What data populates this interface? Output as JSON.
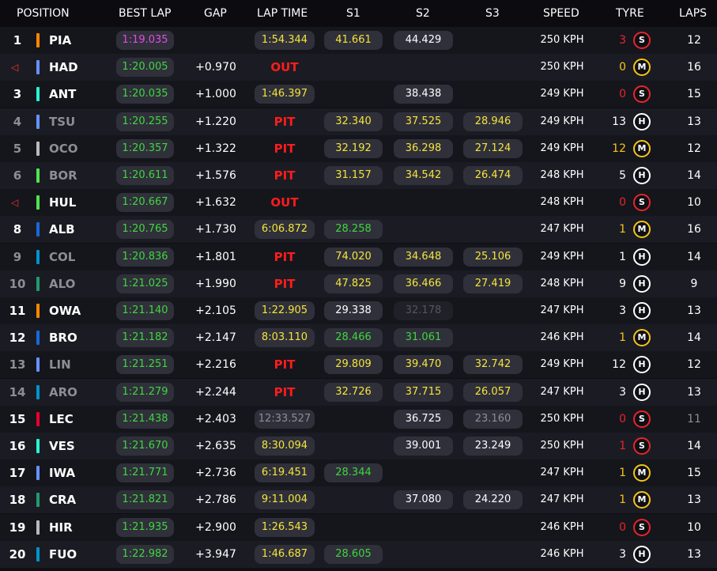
{
  "header": {
    "position": "POSITION",
    "best_lap": "BEST LAP",
    "gap": "GAP",
    "lap_time": "LAP TIME",
    "s1": "S1",
    "s2": "S2",
    "s3": "S3",
    "speed": "SPEED",
    "tyre": "TYRE",
    "laps": "LAPS"
  },
  "tyre_colors": {
    "S": "#e8242c",
    "M": "#f5c518",
    "H": "#ffffff"
  },
  "rows": [
    {
      "pos": "1",
      "flag": false,
      "team": "#ff8700",
      "driver": "PIA",
      "dim": false,
      "best": "1:19.035",
      "best_c": "purple",
      "gap": "",
      "lap": "1:54.344",
      "lap_c": "yellow",
      "status": "",
      "s1": "41.661",
      "s1_c": "yellow",
      "s2": "44.429",
      "s2_c": "white",
      "s3": "",
      "s3_c": "",
      "speed": "250 KPH",
      "tlaps": "3",
      "tlaps_c": "red",
      "tyre": "S",
      "laps": "12"
    },
    {
      "pos": "",
      "flag": true,
      "team": "#6692ff",
      "driver": "HAD",
      "dim": false,
      "best": "1:20.005",
      "best_c": "green",
      "gap": "+0.970",
      "lap": "",
      "lap_c": "",
      "status": "OUT",
      "s1": "",
      "s1_c": "",
      "s2": "",
      "s2_c": "",
      "s3": "",
      "s3_c": "",
      "speed": "250 KPH",
      "tlaps": "0",
      "tlaps_c": "yellow",
      "tyre": "M",
      "laps": "16"
    },
    {
      "pos": "3",
      "flag": false,
      "team": "#27f4d2",
      "driver": "ANT",
      "dim": false,
      "best": "1:20.035",
      "best_c": "green",
      "gap": "+1.000",
      "lap": "1:46.397",
      "lap_c": "yellow",
      "status": "",
      "s1": "",
      "s1_c": "",
      "s2": "38.438",
      "s2_c": "white",
      "s3": "",
      "s3_c": "",
      "speed": "249 KPH",
      "tlaps": "0",
      "tlaps_c": "red",
      "tyre": "S",
      "laps": "15"
    },
    {
      "pos": "4",
      "flag": false,
      "team": "#6692ff",
      "driver": "TSU",
      "dim": true,
      "best": "1:20.255",
      "best_c": "green",
      "gap": "+1.220",
      "lap": "",
      "lap_c": "",
      "status": "PIT",
      "s1": "32.340",
      "s1_c": "yellow",
      "s2": "37.525",
      "s2_c": "yellow",
      "s3": "28.946",
      "s3_c": "yellow",
      "speed": "249 KPH",
      "tlaps": "13",
      "tlaps_c": "white",
      "tyre": "H",
      "laps": "13"
    },
    {
      "pos": "5",
      "flag": false,
      "team": "#b6babd",
      "driver": "OCO",
      "dim": true,
      "best": "1:20.357",
      "best_c": "green",
      "gap": "+1.322",
      "lap": "",
      "lap_c": "",
      "status": "PIT",
      "s1": "32.192",
      "s1_c": "yellow",
      "s2": "36.298",
      "s2_c": "yellow",
      "s3": "27.124",
      "s3_c": "yellow",
      "speed": "249 KPH",
      "tlaps": "12",
      "tlaps_c": "yellow",
      "tyre": "M",
      "laps": "12"
    },
    {
      "pos": "6",
      "flag": false,
      "team": "#52e252",
      "driver": "BOR",
      "dim": true,
      "best": "1:20.611",
      "best_c": "green",
      "gap": "+1.576",
      "lap": "",
      "lap_c": "",
      "status": "PIT",
      "s1": "31.157",
      "s1_c": "yellow",
      "s2": "34.542",
      "s2_c": "yellow",
      "s3": "26.474",
      "s3_c": "yellow",
      "speed": "248 KPH",
      "tlaps": "5",
      "tlaps_c": "white",
      "tyre": "H",
      "laps": "14"
    },
    {
      "pos": "",
      "flag": true,
      "team": "#52e252",
      "driver": "HUL",
      "dim": false,
      "best": "1:20.667",
      "best_c": "green",
      "gap": "+1.632",
      "lap": "",
      "lap_c": "",
      "status": "OUT",
      "s1": "",
      "s1_c": "",
      "s2": "",
      "s2_c": "",
      "s3": "",
      "s3_c": "",
      "speed": "248 KPH",
      "tlaps": "0",
      "tlaps_c": "red",
      "tyre": "S",
      "laps": "10"
    },
    {
      "pos": "8",
      "flag": false,
      "team": "#1868db",
      "driver": "ALB",
      "dim": false,
      "best": "1:20.765",
      "best_c": "green",
      "gap": "+1.730",
      "lap": "6:06.872",
      "lap_c": "yellow",
      "status": "",
      "s1": "28.258",
      "s1_c": "green",
      "s2": "",
      "s2_c": "",
      "s3": "",
      "s3_c": "",
      "speed": "247 KPH",
      "tlaps": "1",
      "tlaps_c": "yellow",
      "tyre": "M",
      "laps": "16"
    },
    {
      "pos": "9",
      "flag": false,
      "team": "#0093cc",
      "driver": "COL",
      "dim": true,
      "best": "1:20.836",
      "best_c": "green",
      "gap": "+1.801",
      "lap": "",
      "lap_c": "",
      "status": "PIT",
      "s1": "74.020",
      "s1_c": "yellow",
      "s2": "34.648",
      "s2_c": "yellow",
      "s3": "25.106",
      "s3_c": "yellow",
      "speed": "249 KPH",
      "tlaps": "1",
      "tlaps_c": "white",
      "tyre": "H",
      "laps": "14"
    },
    {
      "pos": "10",
      "flag": false,
      "team": "#229971",
      "driver": "ALO",
      "dim": true,
      "best": "1:21.025",
      "best_c": "green",
      "gap": "+1.990",
      "lap": "",
      "lap_c": "",
      "status": "PIT",
      "s1": "47.825",
      "s1_c": "yellow",
      "s2": "36.466",
      "s2_c": "yellow",
      "s3": "27.419",
      "s3_c": "yellow",
      "speed": "248 KPH",
      "tlaps": "9",
      "tlaps_c": "white",
      "tyre": "H",
      "laps": "9"
    },
    {
      "pos": "11",
      "flag": false,
      "team": "#ff8700",
      "driver": "OWA",
      "dim": false,
      "best": "1:21.140",
      "best_c": "green",
      "gap": "+2.105",
      "lap": "1:22.905",
      "lap_c": "yellow",
      "status": "",
      "s1": "29.338",
      "s1_c": "white",
      "s2": "32.178",
      "s2_c": "darkgrey",
      "s3": "",
      "s3_c": "",
      "speed": "247 KPH",
      "tlaps": "3",
      "tlaps_c": "white",
      "tyre": "H",
      "laps": "13"
    },
    {
      "pos": "12",
      "flag": false,
      "team": "#1868db",
      "driver": "BRO",
      "dim": false,
      "best": "1:21.182",
      "best_c": "green",
      "gap": "+2.147",
      "lap": "8:03.110",
      "lap_c": "yellow",
      "status": "",
      "s1": "28.466",
      "s1_c": "green",
      "s2": "31.061",
      "s2_c": "green",
      "s3": "",
      "s3_c": "",
      "speed": "246 KPH",
      "tlaps": "1",
      "tlaps_c": "yellow",
      "tyre": "M",
      "laps": "14"
    },
    {
      "pos": "13",
      "flag": false,
      "team": "#6692ff",
      "driver": "LIN",
      "dim": true,
      "best": "1:21.251",
      "best_c": "green",
      "gap": "+2.216",
      "lap": "",
      "lap_c": "",
      "status": "PIT",
      "s1": "29.809",
      "s1_c": "yellow",
      "s2": "39.470",
      "s2_c": "yellow",
      "s3": "32.742",
      "s3_c": "yellow",
      "speed": "249 KPH",
      "tlaps": "12",
      "tlaps_c": "white",
      "tyre": "H",
      "laps": "12"
    },
    {
      "pos": "14",
      "flag": false,
      "team": "#0093cc",
      "driver": "ARO",
      "dim": true,
      "best": "1:21.279",
      "best_c": "green",
      "gap": "+2.244",
      "lap": "",
      "lap_c": "",
      "status": "PIT",
      "s1": "32.726",
      "s1_c": "yellow",
      "s2": "37.715",
      "s2_c": "yellow",
      "s3": "26.057",
      "s3_c": "yellow",
      "speed": "247 KPH",
      "tlaps": "3",
      "tlaps_c": "white",
      "tyre": "H",
      "laps": "13"
    },
    {
      "pos": "15",
      "flag": false,
      "team": "#e8002d",
      "driver": "LEC",
      "dim": false,
      "best": "1:21.438",
      "best_c": "green",
      "gap": "+2.403",
      "lap": "12:33.527",
      "lap_c": "grey",
      "status": "",
      "s1": "",
      "s1_c": "",
      "s2": "36.725",
      "s2_c": "white",
      "s3": "23.160",
      "s3_c": "grey",
      "speed": "250 KPH",
      "tlaps": "0",
      "tlaps_c": "red",
      "tyre": "S",
      "laps": "11",
      "laps_dim": true
    },
    {
      "pos": "16",
      "flag": false,
      "team": "#27f4d2",
      "driver": "VES",
      "dim": false,
      "best": "1:21.670",
      "best_c": "green",
      "gap": "+2.635",
      "lap": "8:30.094",
      "lap_c": "yellow",
      "status": "",
      "s1": "",
      "s1_c": "",
      "s2": "39.001",
      "s2_c": "white",
      "s3": "23.249",
      "s3_c": "white",
      "speed": "250 KPH",
      "tlaps": "1",
      "tlaps_c": "red",
      "tyre": "S",
      "laps": "14"
    },
    {
      "pos": "17",
      "flag": false,
      "team": "#6692ff",
      "driver": "IWA",
      "dim": false,
      "best": "1:21.771",
      "best_c": "green",
      "gap": "+2.736",
      "lap": "6:19.451",
      "lap_c": "yellow",
      "status": "",
      "s1": "28.344",
      "s1_c": "green",
      "s2": "",
      "s2_c": "",
      "s3": "",
      "s3_c": "",
      "speed": "247 KPH",
      "tlaps": "1",
      "tlaps_c": "yellow",
      "tyre": "M",
      "laps": "15"
    },
    {
      "pos": "18",
      "flag": false,
      "team": "#229971",
      "driver": "CRA",
      "dim": false,
      "best": "1:21.821",
      "best_c": "green",
      "gap": "+2.786",
      "lap": "9:11.004",
      "lap_c": "yellow",
      "status": "",
      "s1": "",
      "s1_c": "",
      "s2": "37.080",
      "s2_c": "white",
      "s3": "24.220",
      "s3_c": "white",
      "speed": "247 KPH",
      "tlaps": "1",
      "tlaps_c": "yellow",
      "tyre": "M",
      "laps": "13"
    },
    {
      "pos": "19",
      "flag": false,
      "team": "#b6babd",
      "driver": "HIR",
      "dim": false,
      "best": "1:21.935",
      "best_c": "green",
      "gap": "+2.900",
      "lap": "1:26.543",
      "lap_c": "yellow",
      "status": "",
      "s1": "",
      "s1_c": "",
      "s2": "",
      "s2_c": "",
      "s3": "",
      "s3_c": "",
      "speed": "246 KPH",
      "tlaps": "0",
      "tlaps_c": "red",
      "tyre": "S",
      "laps": "10"
    },
    {
      "pos": "20",
      "flag": false,
      "team": "#0093cc",
      "driver": "FUO",
      "dim": false,
      "best": "1:22.982",
      "best_c": "green",
      "gap": "+3.947",
      "lap": "1:46.687",
      "lap_c": "yellow",
      "status": "",
      "s1": "28.605",
      "s1_c": "green",
      "s2": "",
      "s2_c": "",
      "s3": "",
      "s3_c": "",
      "speed": "246 KPH",
      "tlaps": "3",
      "tlaps_c": "white",
      "tyre": "H",
      "laps": "13"
    }
  ]
}
